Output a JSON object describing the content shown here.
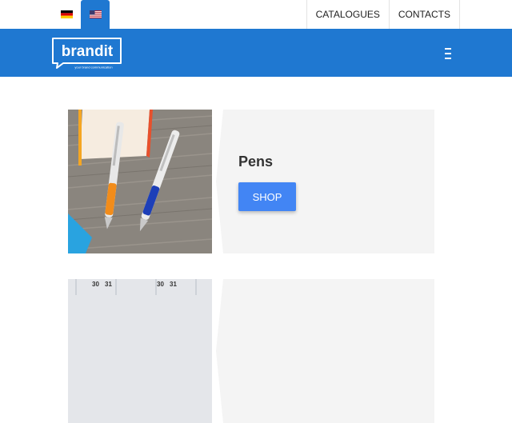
{
  "topbar": {
    "flags": [
      {
        "name": "german-flag-icon",
        "lang": "de"
      },
      {
        "name": "us-flag-icon",
        "lang": "en"
      }
    ],
    "links": [
      "CATALOGUES",
      "CONTACTS"
    ]
  },
  "header": {
    "logo_text": "brandit",
    "logo_tagline": "your brand communication",
    "menu_icon": "hamburger-menu-icon"
  },
  "products": [
    {
      "title": "Pens",
      "button": "SHOP",
      "image": "pens-on-wood-photo"
    },
    {
      "title": "",
      "button": "",
      "image": "calendar-photo"
    }
  ],
  "colors": {
    "header_bg": "#1f78d1",
    "button_bg": "#4285f4",
    "card_bg": "#f4f4f4"
  }
}
